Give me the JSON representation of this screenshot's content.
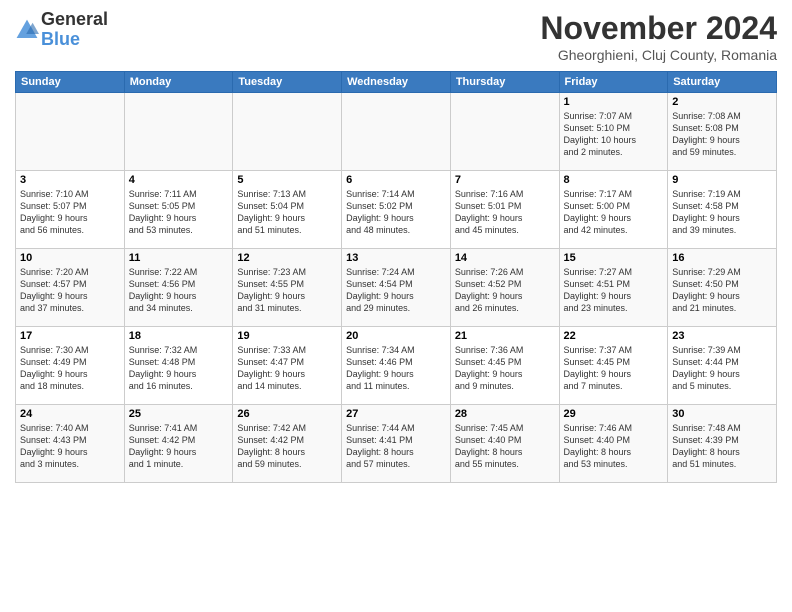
{
  "logo": {
    "general": "General",
    "blue": "Blue"
  },
  "title": "November 2024",
  "location": "Gheorghieni, Cluj County, Romania",
  "days_of_week": [
    "Sunday",
    "Monday",
    "Tuesday",
    "Wednesday",
    "Thursday",
    "Friday",
    "Saturday"
  ],
  "weeks": [
    [
      {
        "day": "",
        "info": ""
      },
      {
        "day": "",
        "info": ""
      },
      {
        "day": "",
        "info": ""
      },
      {
        "day": "",
        "info": ""
      },
      {
        "day": "",
        "info": ""
      },
      {
        "day": "1",
        "info": "Sunrise: 7:07 AM\nSunset: 5:10 PM\nDaylight: 10 hours\nand 2 minutes."
      },
      {
        "day": "2",
        "info": "Sunrise: 7:08 AM\nSunset: 5:08 PM\nDaylight: 9 hours\nand 59 minutes."
      }
    ],
    [
      {
        "day": "3",
        "info": "Sunrise: 7:10 AM\nSunset: 5:07 PM\nDaylight: 9 hours\nand 56 minutes."
      },
      {
        "day": "4",
        "info": "Sunrise: 7:11 AM\nSunset: 5:05 PM\nDaylight: 9 hours\nand 53 minutes."
      },
      {
        "day": "5",
        "info": "Sunrise: 7:13 AM\nSunset: 5:04 PM\nDaylight: 9 hours\nand 51 minutes."
      },
      {
        "day": "6",
        "info": "Sunrise: 7:14 AM\nSunset: 5:02 PM\nDaylight: 9 hours\nand 48 minutes."
      },
      {
        "day": "7",
        "info": "Sunrise: 7:16 AM\nSunset: 5:01 PM\nDaylight: 9 hours\nand 45 minutes."
      },
      {
        "day": "8",
        "info": "Sunrise: 7:17 AM\nSunset: 5:00 PM\nDaylight: 9 hours\nand 42 minutes."
      },
      {
        "day": "9",
        "info": "Sunrise: 7:19 AM\nSunset: 4:58 PM\nDaylight: 9 hours\nand 39 minutes."
      }
    ],
    [
      {
        "day": "10",
        "info": "Sunrise: 7:20 AM\nSunset: 4:57 PM\nDaylight: 9 hours\nand 37 minutes."
      },
      {
        "day": "11",
        "info": "Sunrise: 7:22 AM\nSunset: 4:56 PM\nDaylight: 9 hours\nand 34 minutes."
      },
      {
        "day": "12",
        "info": "Sunrise: 7:23 AM\nSunset: 4:55 PM\nDaylight: 9 hours\nand 31 minutes."
      },
      {
        "day": "13",
        "info": "Sunrise: 7:24 AM\nSunset: 4:54 PM\nDaylight: 9 hours\nand 29 minutes."
      },
      {
        "day": "14",
        "info": "Sunrise: 7:26 AM\nSunset: 4:52 PM\nDaylight: 9 hours\nand 26 minutes."
      },
      {
        "day": "15",
        "info": "Sunrise: 7:27 AM\nSunset: 4:51 PM\nDaylight: 9 hours\nand 23 minutes."
      },
      {
        "day": "16",
        "info": "Sunrise: 7:29 AM\nSunset: 4:50 PM\nDaylight: 9 hours\nand 21 minutes."
      }
    ],
    [
      {
        "day": "17",
        "info": "Sunrise: 7:30 AM\nSunset: 4:49 PM\nDaylight: 9 hours\nand 18 minutes."
      },
      {
        "day": "18",
        "info": "Sunrise: 7:32 AM\nSunset: 4:48 PM\nDaylight: 9 hours\nand 16 minutes."
      },
      {
        "day": "19",
        "info": "Sunrise: 7:33 AM\nSunset: 4:47 PM\nDaylight: 9 hours\nand 14 minutes."
      },
      {
        "day": "20",
        "info": "Sunrise: 7:34 AM\nSunset: 4:46 PM\nDaylight: 9 hours\nand 11 minutes."
      },
      {
        "day": "21",
        "info": "Sunrise: 7:36 AM\nSunset: 4:45 PM\nDaylight: 9 hours\nand 9 minutes."
      },
      {
        "day": "22",
        "info": "Sunrise: 7:37 AM\nSunset: 4:45 PM\nDaylight: 9 hours\nand 7 minutes."
      },
      {
        "day": "23",
        "info": "Sunrise: 7:39 AM\nSunset: 4:44 PM\nDaylight: 9 hours\nand 5 minutes."
      }
    ],
    [
      {
        "day": "24",
        "info": "Sunrise: 7:40 AM\nSunset: 4:43 PM\nDaylight: 9 hours\nand 3 minutes."
      },
      {
        "day": "25",
        "info": "Sunrise: 7:41 AM\nSunset: 4:42 PM\nDaylight: 9 hours\nand 1 minute."
      },
      {
        "day": "26",
        "info": "Sunrise: 7:42 AM\nSunset: 4:42 PM\nDaylight: 8 hours\nand 59 minutes."
      },
      {
        "day": "27",
        "info": "Sunrise: 7:44 AM\nSunset: 4:41 PM\nDaylight: 8 hours\nand 57 minutes."
      },
      {
        "day": "28",
        "info": "Sunrise: 7:45 AM\nSunset: 4:40 PM\nDaylight: 8 hours\nand 55 minutes."
      },
      {
        "day": "29",
        "info": "Sunrise: 7:46 AM\nSunset: 4:40 PM\nDaylight: 8 hours\nand 53 minutes."
      },
      {
        "day": "30",
        "info": "Sunrise: 7:48 AM\nSunset: 4:39 PM\nDaylight: 8 hours\nand 51 minutes."
      }
    ]
  ]
}
